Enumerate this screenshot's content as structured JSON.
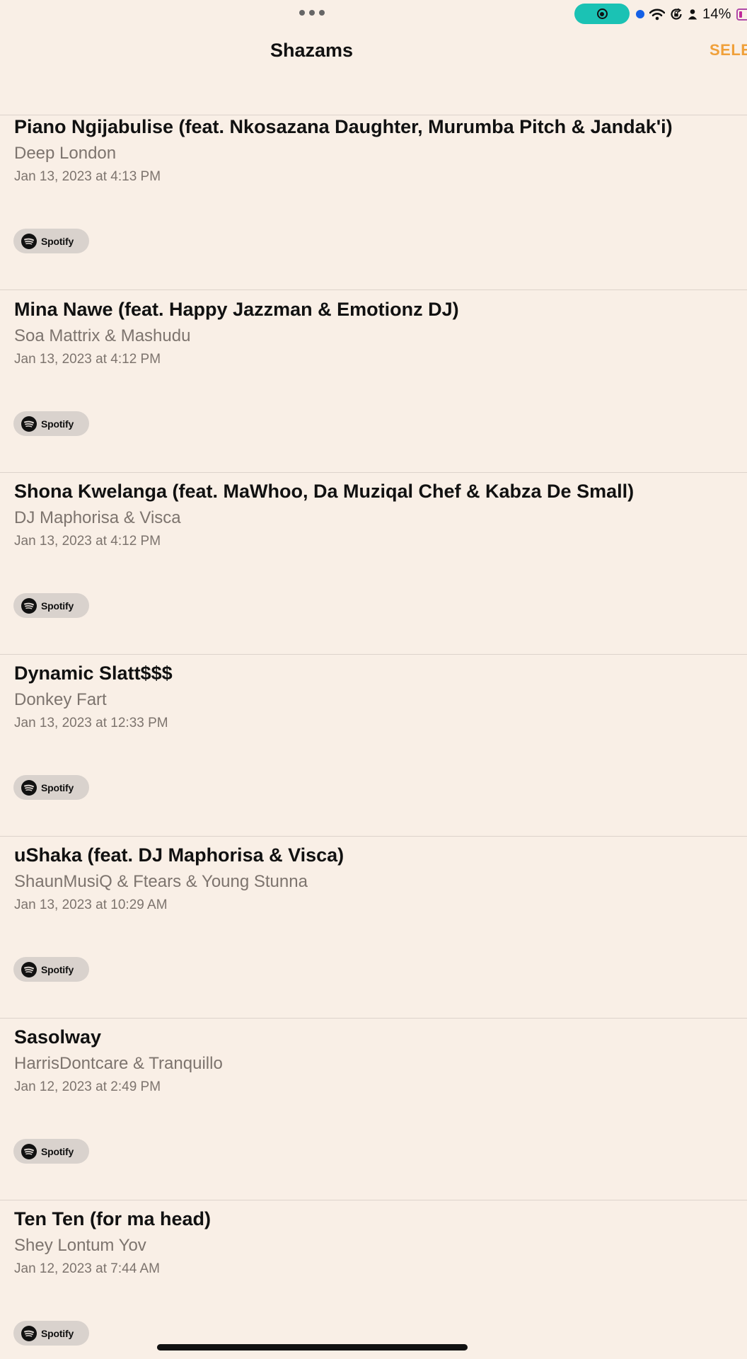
{
  "status_bar": {
    "battery_percent": "14%",
    "icons": [
      "more-dots-icon",
      "screen-record-icon",
      "location-dot-icon",
      "wifi-icon",
      "orientation-lock-icon",
      "person-icon",
      "battery-icon"
    ],
    "record_color": "#1bc2b4",
    "battery_level_fraction": 0.14
  },
  "nav": {
    "title": "Shazams",
    "select_label": "SELE",
    "accent_color": "#f0a03a"
  },
  "items": [
    {
      "title": "Piano Ngijabulise (feat. Nkosazana Daughter, Murumba Pitch & Jandak'i)",
      "artist": "Deep London",
      "date": "Jan 13, 2023 at 4:13 PM",
      "service": "Spotify"
    },
    {
      "title": "Mina Nawe (feat. Happy Jazzman & Emotionz DJ)",
      "artist": "Soa Mattrix & Mashudu",
      "date": "Jan 13, 2023 at 4:12 PM",
      "service": "Spotify"
    },
    {
      "title": "Shona Kwelanga (feat. MaWhoo, Da Muziqal Chef & Kabza De Small)",
      "artist": "DJ Maphorisa & Visca",
      "date": "Jan 13, 2023 at 4:12 PM",
      "service": "Spotify"
    },
    {
      "title": "Dynamic Slatt$$$",
      "artist": "Donkey Fart",
      "date": "Jan 13, 2023 at 12:33 PM",
      "service": "Spotify"
    },
    {
      "title": "uShaka (feat. DJ Maphorisa & Visca)",
      "artist": "ShaunMusiQ & Ftears & Young Stunna",
      "date": "Jan 13, 2023 at 10:29 AM",
      "service": "Spotify"
    },
    {
      "title": "Sasolway",
      "artist": "HarrisDontcare & Tranquillo",
      "date": "Jan 12, 2023 at 2:49 PM",
      "service": "Spotify"
    },
    {
      "title": "Ten Ten (for ma head)",
      "artist": "Shey Lontum Yov",
      "date": "Jan 12, 2023 at 7:44 AM",
      "service": "Spotify"
    }
  ]
}
